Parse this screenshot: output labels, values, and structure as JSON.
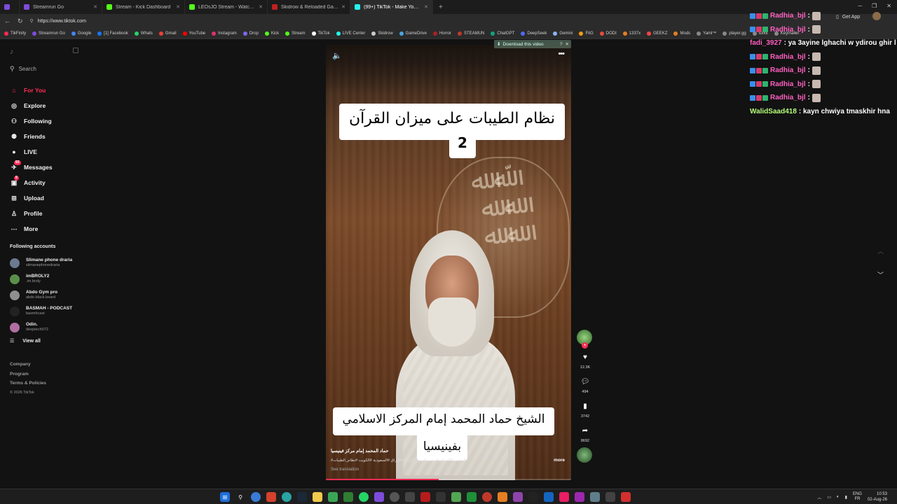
{
  "browser": {
    "tabs": [
      {
        "label": "",
        "color": "#7d4cdb",
        "active": false,
        "small": true
      },
      {
        "label": "Streamrun Go",
        "color": "#7d4cdb",
        "active": false
      },
      {
        "label": "Stream - Kick Dashboard",
        "color": "#53fc18",
        "active": false
      },
      {
        "label": "LEOsJO Stream - Watch Live o",
        "color": "#53fc18",
        "active": false
      },
      {
        "label": "Skidrow & Reloaded Games – Dow",
        "color": "#c02020",
        "active": false
      },
      {
        "label": "(99+) TikTok - Make Your Day",
        "color": "#25f4ee",
        "active": true
      }
    ],
    "new_tab": "+",
    "url": "https://www.tiktok.com",
    "bookmarks": [
      {
        "label": "TikFinity",
        "color": "#fe2c55"
      },
      {
        "label": "Streamrun Go",
        "color": "#7d4cdb"
      },
      {
        "label": "Google",
        "color": "#4285f4"
      },
      {
        "label": "[1] Facebook",
        "color": "#1877f2"
      },
      {
        "label": "Whats",
        "color": "#25d366"
      },
      {
        "label": "Gmail",
        "color": "#ea4335"
      },
      {
        "label": "YouTube",
        "color": "#ff0000"
      },
      {
        "label": "Instagram",
        "color": "#e1306c"
      },
      {
        "label": "Drop",
        "color": "#7b68ee"
      },
      {
        "label": "Kick",
        "color": "#53fc18"
      },
      {
        "label": "Stream",
        "color": "#53fc18"
      },
      {
        "label": "TikTok",
        "color": "#ffffff"
      },
      {
        "label": "LIVE Center",
        "color": "#25f4ee"
      },
      {
        "label": "Skidrow",
        "color": "#cccccc"
      },
      {
        "label": "GameDrive",
        "color": "#4aa3df"
      },
      {
        "label": "Horror",
        "color": "#aa2222"
      },
      {
        "label": "STEAMUN",
        "color": "#c0392b"
      },
      {
        "label": "ChatGPT",
        "color": "#10a37f"
      },
      {
        "label": "DeepSeek",
        "color": "#4d6bfe"
      },
      {
        "label": "Gemini",
        "color": "#8ab4f8"
      },
      {
        "label": "FitG",
        "color": "#f39c12"
      },
      {
        "label": "DODI",
        "color": "#e74c3c"
      },
      {
        "label": "1337x",
        "color": "#e67e22"
      },
      {
        "label": "GEEKZ",
        "color": "#ff4444"
      },
      {
        "label": "Mods",
        "color": "#e67e22"
      },
      {
        "label": "Yaml™",
        "color": "#888888"
      },
      {
        "label": "player.gg",
        "color": "#888888"
      },
      {
        "label": "turkit",
        "color": "#888888"
      },
      {
        "label": "Keymailer",
        "color": "#888888"
      }
    ]
  },
  "tiktok": {
    "search_placeholder": "Search",
    "nav": [
      {
        "label": "For You",
        "icon": "home-icon",
        "glyph": "⌂",
        "active": true
      },
      {
        "label": "Explore",
        "icon": "compass-icon",
        "glyph": "◎"
      },
      {
        "label": "Following",
        "icon": "following-icon",
        "glyph": "⚇"
      },
      {
        "label": "Friends",
        "icon": "friends-icon",
        "glyph": "⚉"
      },
      {
        "label": "LIVE",
        "icon": "live-icon",
        "glyph": "●"
      },
      {
        "label": "Messages",
        "icon": "messages-icon",
        "glyph": "✈",
        "badge": "93"
      },
      {
        "label": "Activity",
        "icon": "activity-icon",
        "glyph": "▣",
        "badge": "9"
      },
      {
        "label": "Upload",
        "icon": "upload-icon",
        "glyph": "⊞"
      },
      {
        "label": "Profile",
        "icon": "profile-icon",
        "glyph": "♙"
      },
      {
        "label": "More",
        "icon": "more-icon",
        "glyph": "⋯"
      }
    ],
    "following_title": "Following accounts",
    "accounts": [
      {
        "name": "Slimane phone draria",
        "handle": "slimanephonedraria",
        "color": "#6b7a8f"
      },
      {
        "name": "imBROLY2",
        "handle": ".im.broly",
        "color": "#5a8f4a"
      },
      {
        "name": "Abdo Gym pro",
        "handle": "abdo.black.beard",
        "color": "#8f8f8f"
      },
      {
        "name": "BASMAH - PODCAST",
        "handle": "basmhcast",
        "color": "#222222"
      },
      {
        "name": "Odin.",
        "handle": "deeptech072",
        "color": "#b06fa0"
      }
    ],
    "view_all": "View all",
    "footer": [
      "Company",
      "Program",
      "Terms & Policies"
    ],
    "copyright": "© 2026 TikTok"
  },
  "video": {
    "download_label": "Download this video",
    "download_help": "?",
    "title_text": "نظام الطيبات على ميزان القرآن",
    "title_number": "2",
    "subtitle_text": "الشيخ حماد المحمد إمام المركز الاسلامي",
    "subtitle_text2": "بفينيسيا",
    "creator_name": "حماد المحمد إمام مركز فينيسيا",
    "hashtags": "#المغرب #الجزائر #تونس #سوريا #تركيا #العراق #السعودية #الكويت #نظام_الطيبات ...",
    "more_label": "more",
    "see_translation": "See translation",
    "progress": 0.46,
    "likes": "12.3K",
    "comments": "494",
    "saves": "3742",
    "shares": "8692"
  },
  "topright": {
    "get_app": "Get App"
  },
  "chat": [
    {
      "user": "Radhia_bjl",
      "msg": ":",
      "color": "#ff5fc1",
      "emote": true
    },
    {
      "user": "Radhia_bjl",
      "msg": ":",
      "color": "#ff5fc1",
      "emote": true
    },
    {
      "user": "fadi_3927",
      "msg": ": ya 3ayine lghachi w ydirou ghir l",
      "color": "#ff5fc1",
      "emote": false,
      "nobadge": true
    },
    {
      "user": "Radhia_bjl",
      "msg": ":",
      "color": "#ff5fc1",
      "emote": true
    },
    {
      "user": "Radhia_bjl",
      "msg": ":",
      "color": "#ff5fc1",
      "emote": true
    },
    {
      "user": "Radhia_bjl",
      "msg": ":",
      "color": "#ff5fc1",
      "emote": true
    },
    {
      "user": "Radhia_bjl",
      "msg": ":",
      "color": "#ff5fc1",
      "emote": true
    },
    {
      "user": "WalidSaad418",
      "msg": ": kayn chwiya tmaskhir hna",
      "color": "#b6ff7a",
      "emote": false,
      "nobadge": true
    }
  ],
  "taskbar": {
    "lang_line1": "ENG",
    "lang_line2": "FR",
    "time": "10:53",
    "date": "02-Aug-26"
  }
}
